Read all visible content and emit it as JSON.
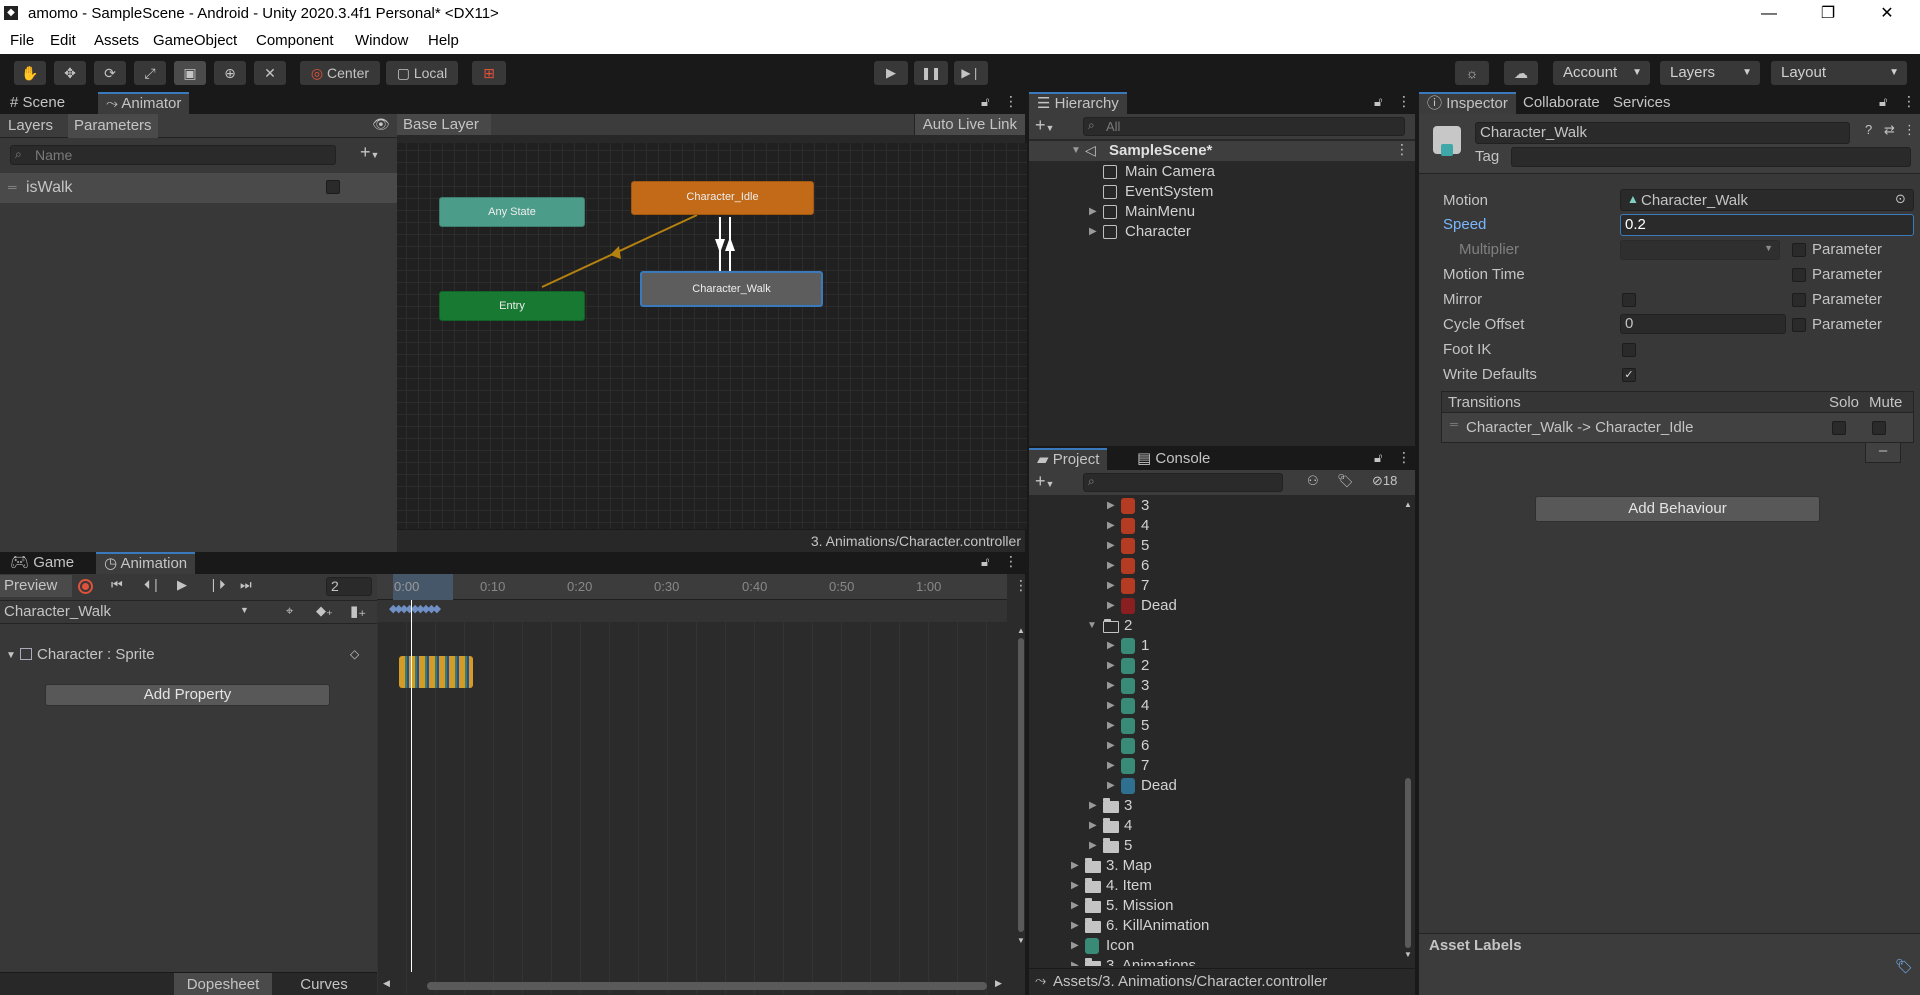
{
  "window": {
    "title": "amomo - SampleScene - Android - Unity 2020.3.4f1 Personal* <DX11>",
    "controls": [
      "—",
      "❐",
      "✕"
    ]
  },
  "menu": [
    "File",
    "Edit",
    "Assets",
    "GameObject",
    "Component",
    "Window",
    "Help"
  ],
  "toolbar": {
    "pivot": "Center",
    "space": "Local",
    "account": "Account",
    "layers": "Layers",
    "layout": "Layout"
  },
  "animator": {
    "tabs": [
      "Scene",
      "Animator"
    ],
    "subtabs": [
      "Layers",
      "Parameters"
    ],
    "breadcrumb": "Base Layer",
    "auto_live_link": "Auto Live Link",
    "search_placeholder": "Name",
    "parameters": [
      {
        "name": "isWalk",
        "value": false
      }
    ],
    "nodes": {
      "any_state": "Any State",
      "entry": "Entry",
      "idle": "Character_Idle",
      "walk": "Character_Walk"
    },
    "footer_path": "3. Animations/Character.controller"
  },
  "animation": {
    "tabs": [
      "Game",
      "Animation"
    ],
    "preview": "Preview",
    "frame": "2",
    "clip": "Character_Walk",
    "ruler": [
      "0:00",
      "0:10",
      "0:20",
      "0:30",
      "0:40",
      "0:50",
      "1:00"
    ],
    "property": "Character : Sprite",
    "add_property": "Add Property",
    "bottom_tabs": [
      "Dopesheet",
      "Curves"
    ]
  },
  "hierarchy": {
    "tab": "Hierarchy",
    "search_placeholder": "All",
    "scene": "SampleScene*",
    "items": [
      "Main Camera",
      "EventSystem",
      "MainMenu",
      "Character"
    ]
  },
  "project": {
    "tabs": [
      "Project",
      "Console"
    ],
    "hidden_count": "18",
    "items_top": [
      "3",
      "4",
      "5",
      "6",
      "7",
      "Dead"
    ],
    "folder_2": "2",
    "items_2": [
      "1",
      "2",
      "3",
      "4",
      "5",
      "6",
      "7",
      "Dead"
    ],
    "folders_after": [
      "3",
      "4",
      "5"
    ],
    "root_folders": [
      "3. Map",
      "4. Item",
      "5. Mission",
      "6. KillAnimation"
    ],
    "icon_item": "Icon",
    "partial_item": "3. Animations",
    "path": "Assets/3. Animations/Character.controller"
  },
  "inspector": {
    "tabs": [
      "Inspector",
      "Collaborate",
      "Services"
    ],
    "name": "Character_Walk",
    "tag_label": "Tag",
    "rows": {
      "motion_label": "Motion",
      "motion_value": "Character_Walk",
      "speed_label": "Speed",
      "speed_value": "0.2",
      "multiplier_label": "Multiplier",
      "motion_time_label": "Motion Time",
      "mirror_label": "Mirror",
      "cycle_offset_label": "Cycle Offset",
      "cycle_offset_value": "0",
      "foot_ik_label": "Foot IK",
      "write_defaults_label": "Write Defaults",
      "parameter_label": "Parameter"
    },
    "transitions": {
      "header": "Transitions",
      "solo": "Solo",
      "mute": "Mute",
      "item": "Character_Walk -> Character_Idle",
      "remove": "–"
    },
    "add_behaviour": "Add Behaviour",
    "asset_labels": "Asset Labels"
  },
  "colors": {
    "accent": "#3a79bb",
    "idle_node": "#c26a17",
    "entry_node": "#187a32",
    "any_state_node": "#4c9c8a",
    "walk_node": "#5d5d5d",
    "record": "#e0523a"
  }
}
